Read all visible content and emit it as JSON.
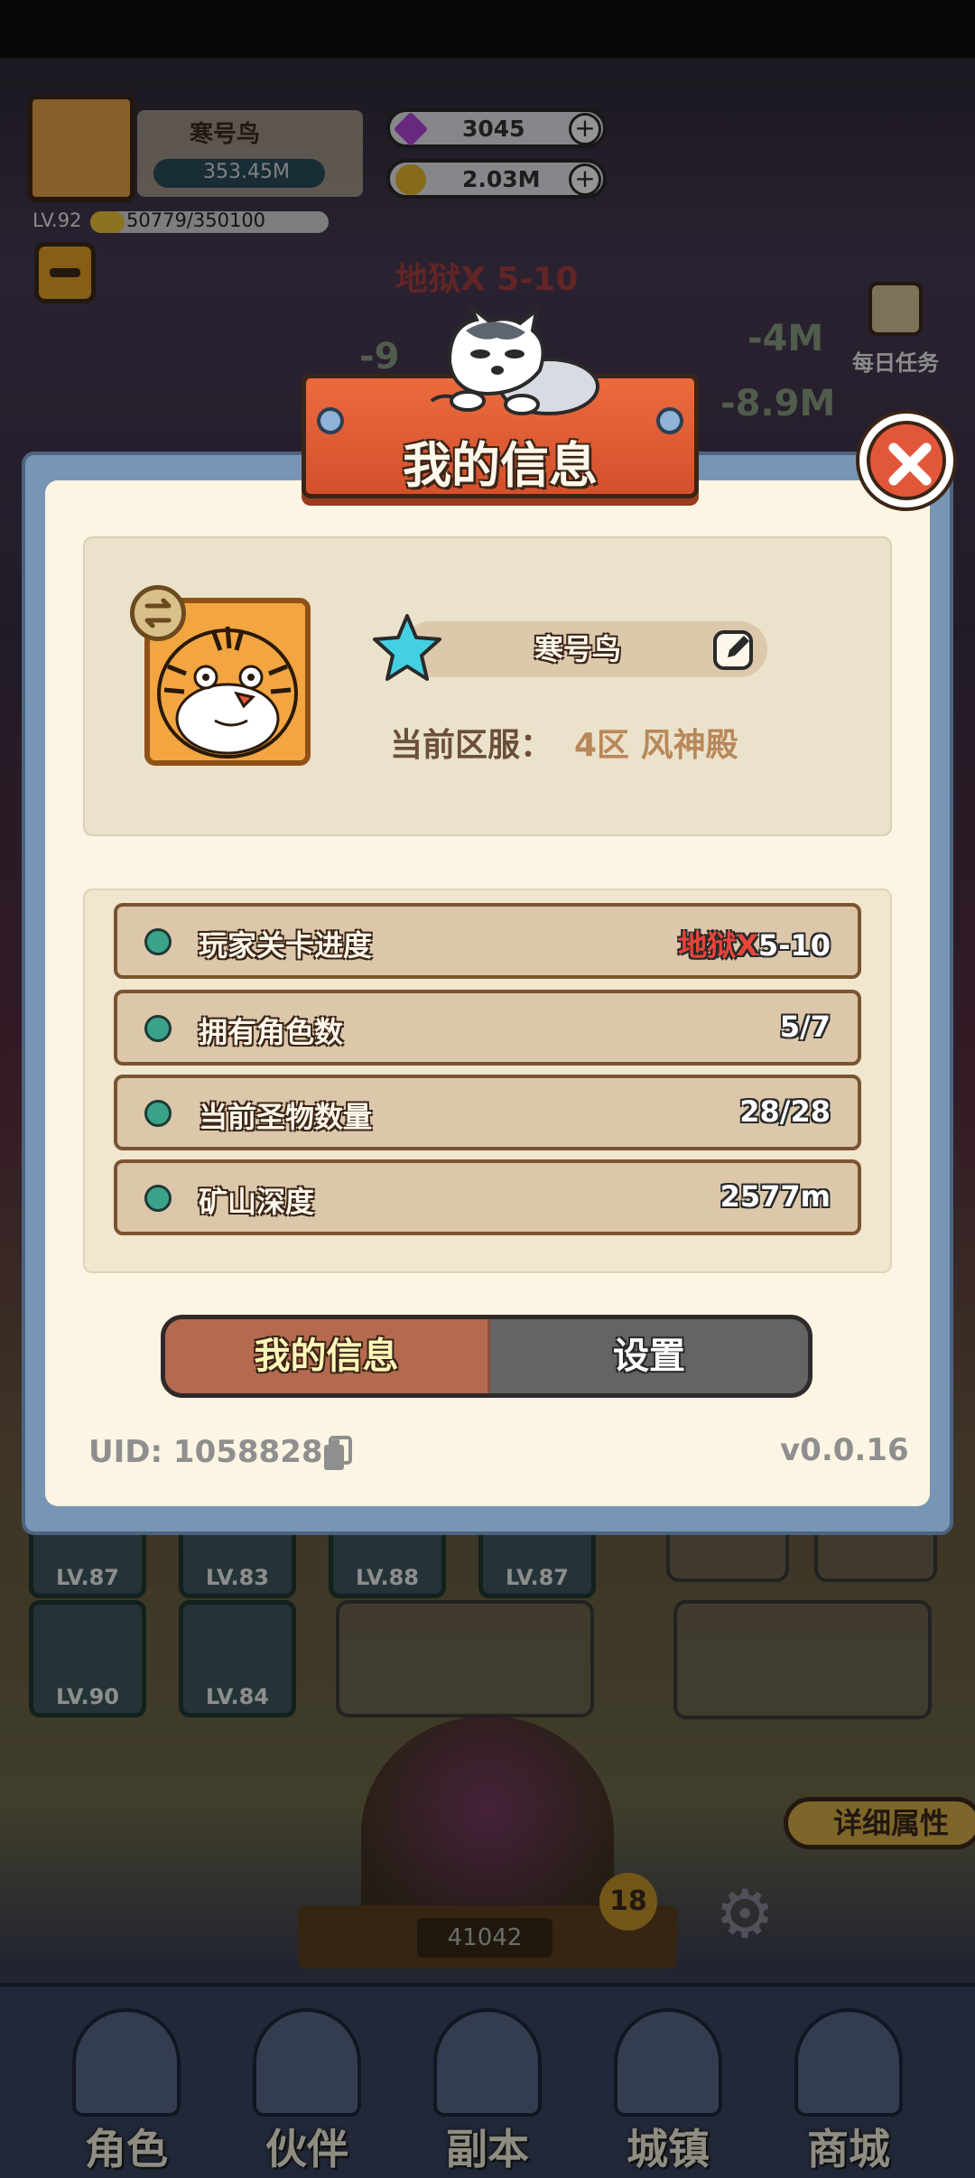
{
  "hud": {
    "player_name": "寒号鸟",
    "power": "353.45M",
    "level": "LV.92",
    "exp": "50779/350100",
    "exp_fraction": 0.145,
    "gems": "3045",
    "coins": "2.03M",
    "stage": "地狱X 5-10",
    "daily_task": "每日任务",
    "damage_numbers": [
      "-9",
      "-4M",
      "-8.9M"
    ]
  },
  "scene": {
    "equip_levels": [
      "LV.87",
      "LV.83",
      "LV.88",
      "LV.87",
      "LV.90",
      "LV.84"
    ],
    "detail_attr": "详细属性",
    "altar_score": "41042",
    "altar_count": "18"
  },
  "bottom_nav": [
    {
      "label": "角色"
    },
    {
      "label": "伙伴"
    },
    {
      "label": "副本"
    },
    {
      "label": "城镇"
    },
    {
      "label": "商城"
    }
  ],
  "dialog": {
    "title": "我的信息",
    "player_name": "寒号鸟",
    "server_label": "当前区服：",
    "server_value": "4区 风神殿",
    "stats": [
      {
        "label": "玩家关卡进度",
        "value_prefix": "地狱X",
        "value": "5-10"
      },
      {
        "label": "拥有角色数",
        "value_prefix": "",
        "value": "5/7"
      },
      {
        "label": "当前圣物数量",
        "value_prefix": "",
        "value": "28/28"
      },
      {
        "label": "矿山深度",
        "value_prefix": "",
        "value": "2577m"
      }
    ],
    "tabs": {
      "my_info": "我的信息",
      "settings": "设置"
    },
    "uid": "UID: 10588284",
    "version": "v0.0.16"
  },
  "colors": {
    "banner": "#d4502c",
    "close": "#e2573a",
    "accent_server": "#b98859",
    "stat_dot": "#3aa389"
  }
}
